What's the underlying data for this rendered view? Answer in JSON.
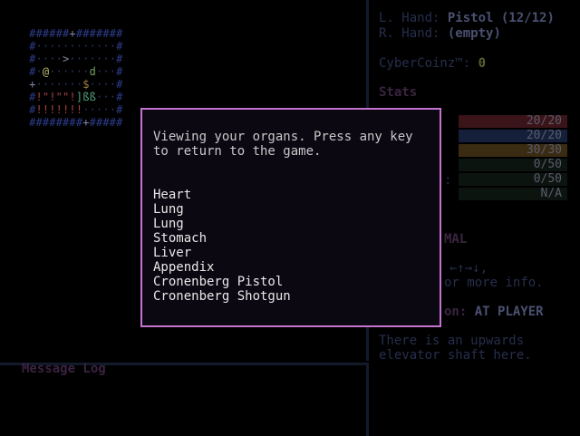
{
  "hands": {
    "left_label": "L. Hand:",
    "left_value": "Pistol (12/12)",
    "right_label": "R. Hand:",
    "right_value": "(empty)"
  },
  "currency": {
    "label": "CyberCoinz™:",
    "value": "0"
  },
  "stats": {
    "title": "Stats",
    "bars": [
      {
        "value": "20/20",
        "color": "#3a1418"
      },
      {
        "value": "20/20",
        "color": "#14203a"
      },
      {
        "value": "30/30",
        "color": "#3a2c12"
      },
      {
        "value": "0/50",
        "color": "#0c1410"
      },
      {
        "value": "0/50",
        "color": "#0c1410"
      },
      {
        "value": "N/A",
        "color": "#0c1410"
      }
    ],
    "partial_label": ":"
  },
  "status": {
    "mode_partial": "MAL",
    "arrows": "←↑→↓,",
    "info_partial": "or more info.",
    "target_partial": "on:",
    "target_value": "AT PLAYER"
  },
  "description": "There is an upwards elevator shaft here.",
  "message_log": {
    "title": "Message Log"
  },
  "modal": {
    "message": "Viewing your organs. Press any key to return to the game.",
    "organs": [
      "Heart",
      "Lung",
      "Lung",
      "Stomach",
      "Liver",
      "Appendix",
      "Cronenberg Pistol",
      "Cronenberg Shotgun"
    ],
    "border_color": "#c474d0"
  },
  "map": {
    "rows": [
      "######+#######",
      "#............#",
      "#....>.......#",
      "#.@......d...#",
      "+.......$....#",
      "#!\"!\"\"!]ßß...#",
      "#!!!!!!!.....#",
      "########+#####"
    ]
  }
}
